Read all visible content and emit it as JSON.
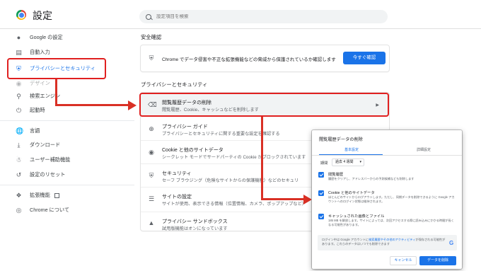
{
  "header": {
    "app_title": "設定",
    "search_placeholder": "設定項目を検索"
  },
  "sidebar": {
    "items": [
      {
        "label": "Google の設定",
        "icon": "person-icon"
      },
      {
        "label": "自動入力",
        "icon": "autofill-icon"
      },
      {
        "label": "プライバシーとセキュリティ",
        "icon": "shield-icon",
        "active": true
      },
      {
        "label": "デザイン",
        "icon": "palette-icon"
      },
      {
        "label": "検索エンジン",
        "icon": "search-icon"
      },
      {
        "label": "起動時",
        "icon": "power-icon"
      },
      {
        "label": "言語",
        "icon": "globe-icon"
      },
      {
        "label": "ダウンロード",
        "icon": "download-icon"
      },
      {
        "label": "ユーザー補助機能",
        "icon": "accessibility-icon"
      },
      {
        "label": "設定のリセット",
        "icon": "reset-icon"
      },
      {
        "label": "拡張機能",
        "icon": "puzzle-icon"
      },
      {
        "label": "Chrome について",
        "icon": "chrome-icon"
      }
    ]
  },
  "safety": {
    "heading": "安全確認",
    "text": "Chrome でデータ侵害や不正な拡張機能などの脅威から保護されているか確認します",
    "button": "今すぐ確認"
  },
  "privacy": {
    "heading": "プライバシーとセキュリティ",
    "rows": [
      {
        "title": "閲覧履歴データの削除",
        "sub": "閲覧履歴、Cookie、キャッシュなどを削除します",
        "icon": "trash-icon"
      },
      {
        "title": "プライバシー ガイド",
        "sub": "プライバシーとセキュリティに関する重要な設定を確認する",
        "icon": "compass-icon"
      },
      {
        "title": "Cookie と他のサイトデータ",
        "sub": "シークレット モードでサードパーティの Cookie がブロックされています",
        "icon": "cookie-icon"
      },
      {
        "title": "セキュリティ",
        "sub": "セーフ ブラウジング（危険なサイトからの保護機能）などのセキュリ",
        "icon": "shield-icon"
      },
      {
        "title": "サイトの設定",
        "sub": "サイトが使用、表示できる情報（位置情報、カメラ、ポップアップなど）",
        "icon": "sliders-icon"
      },
      {
        "title": "プライバシー サンドボックス",
        "sub": "試用版機能はオンになっています",
        "icon": "flask-icon"
      }
    ]
  },
  "dialog": {
    "title": "閲覧履歴データの削除",
    "tab_basic": "基本設定",
    "tab_advanced": "詳細設定",
    "period_label": "期間",
    "period_value": "過去 4 週間",
    "options": [
      {
        "title": "閲覧履歴",
        "sub": "履歴をクリアし、アドレスバーからの予測候補なども削除します",
        "checked": true
      },
      {
        "title": "Cookie と他のサイトデータ",
        "sub": "ほとんどのサイトからログアウトします。ただし、同期データを削除できるように Google アカウントへのログイン状態は維持されます。",
        "checked": true
      },
      {
        "title": "キャッシュされた画像とファイル",
        "sub": "185 MB を解放します。サイトによっては、次回アクセスする際に読み込みにかかる時間が長くなる可能性があります。",
        "checked": true
      }
    ],
    "notice_prefix": "ログイン中は Google アカウントに",
    "notice_link": "検索履歴やその他のアクティビティ",
    "notice_suffix": "が保存される可能性があります。これらのデータはいつでも削除できます",
    "cancel": "キャンセル",
    "delete": "データを削除"
  },
  "colors": {
    "accent": "#1a73e8",
    "highlight": "#e02020"
  }
}
